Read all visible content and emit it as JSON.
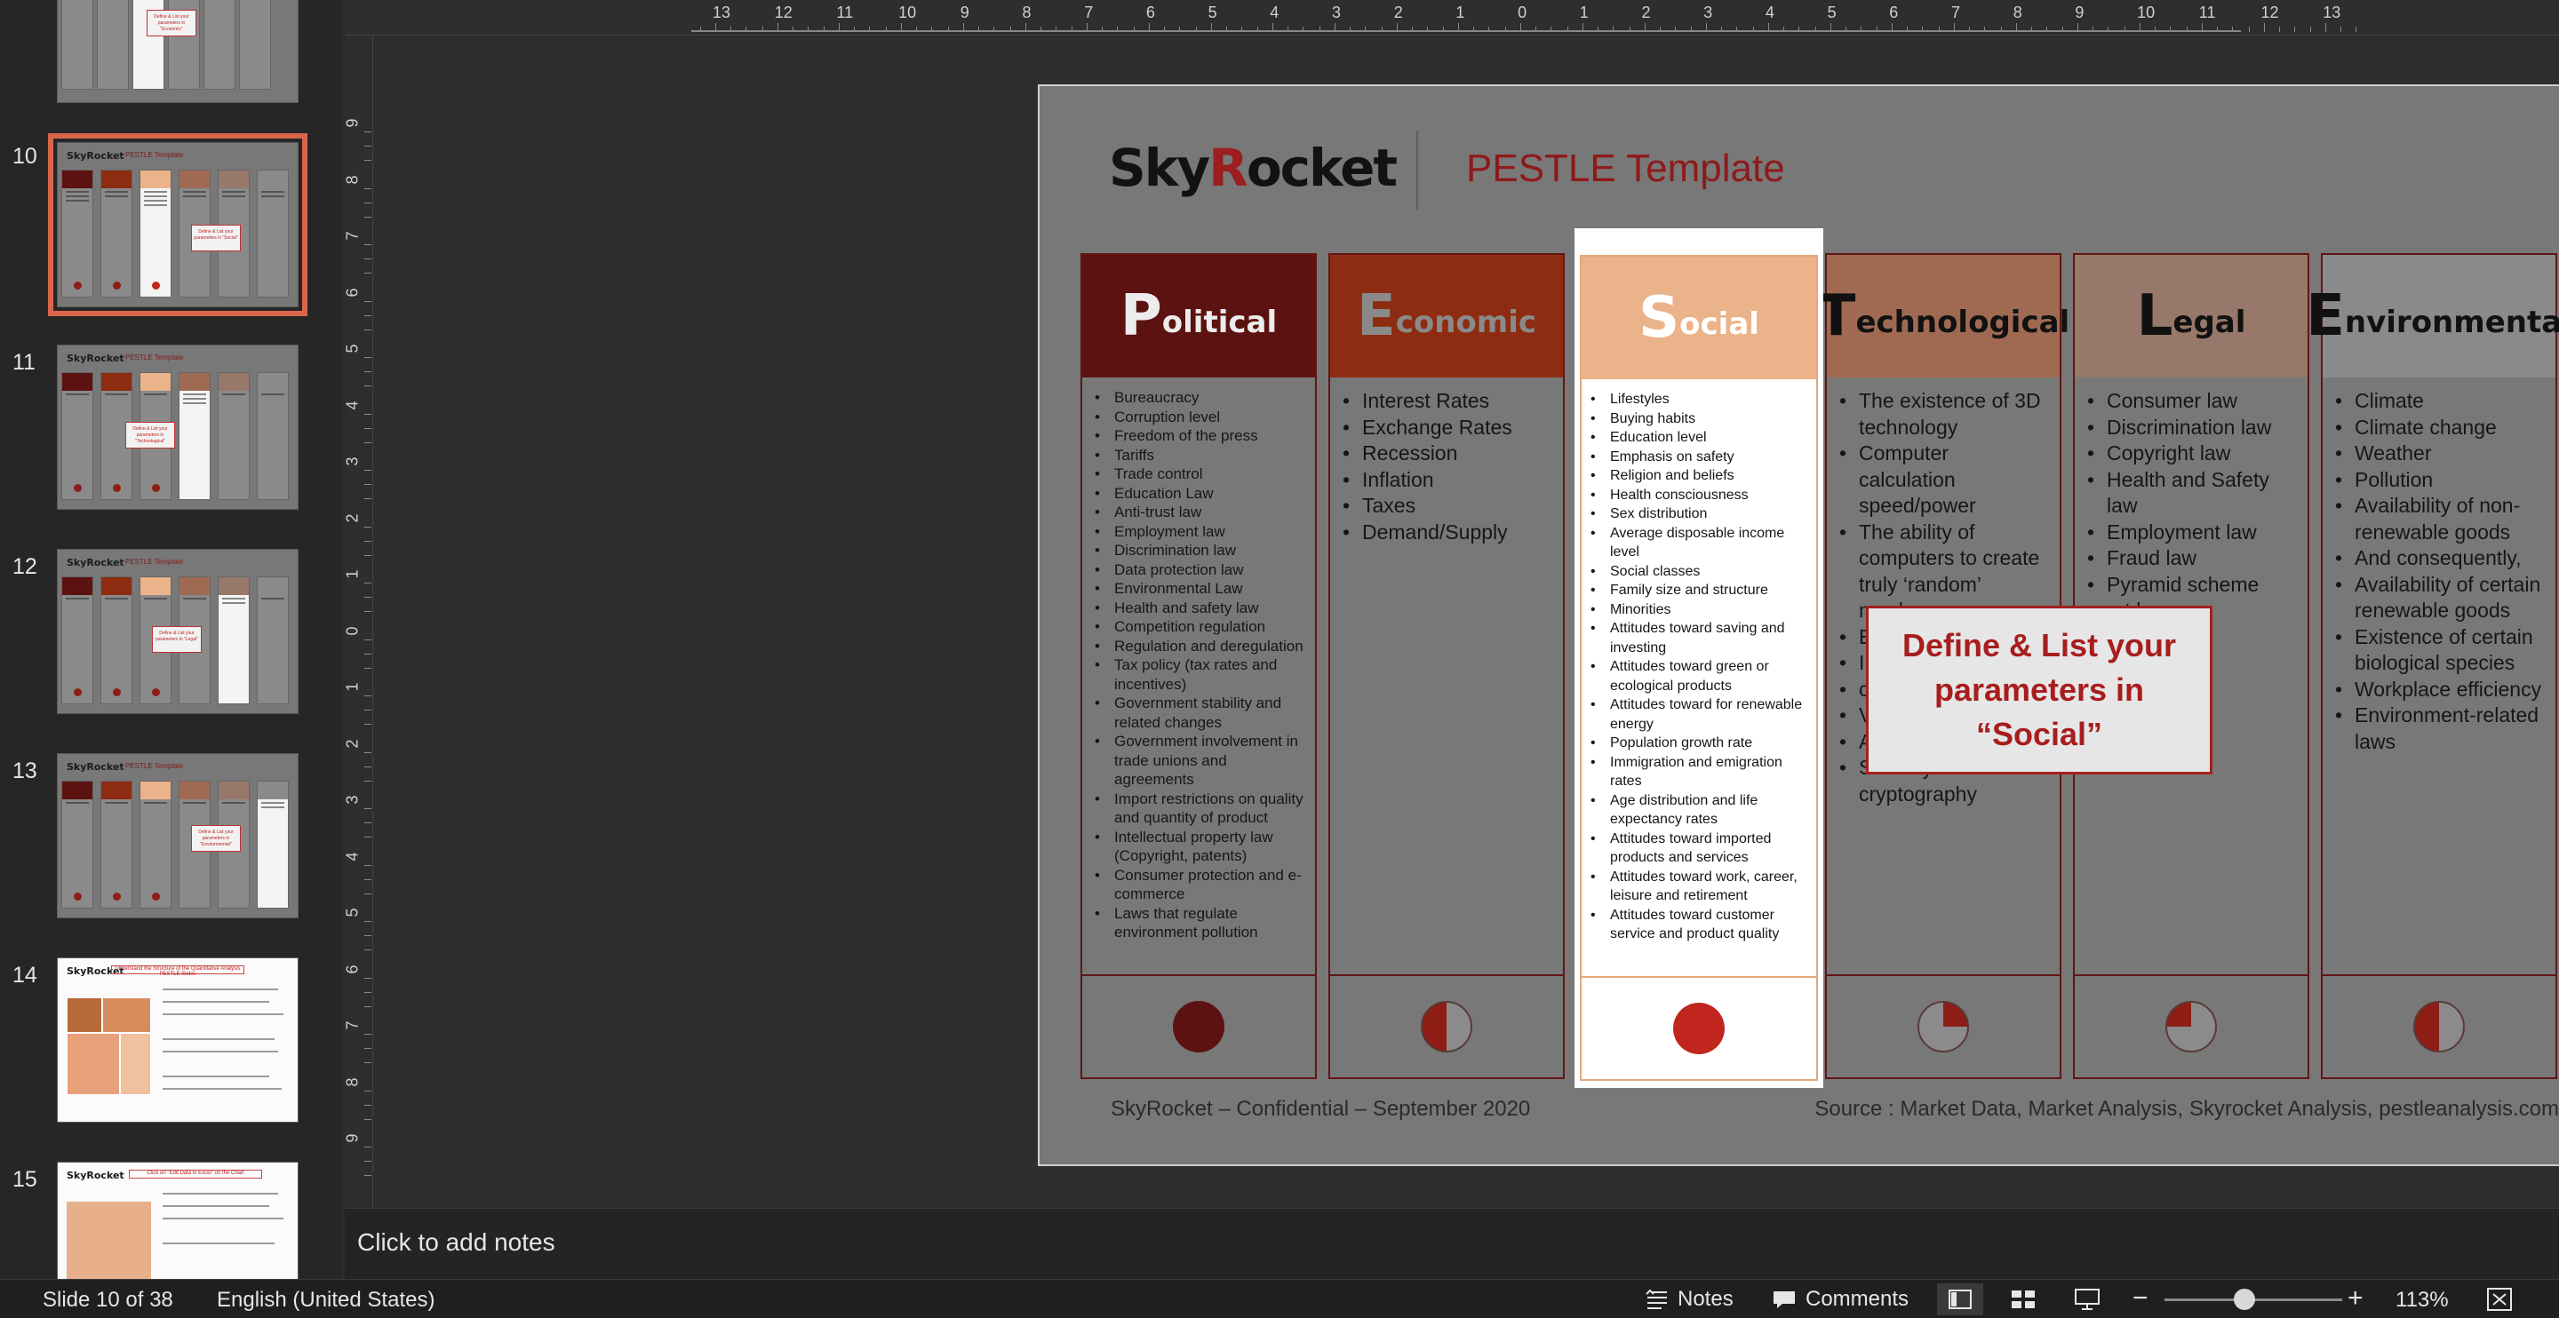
{
  "thumbnails": {
    "items": [
      {
        "number": "",
        "selected": false,
        "callout": "Define & List your parameters in \"Economic\""
      },
      {
        "number": "10",
        "selected": true,
        "callout": "Define & List your parameters in \"Social\""
      },
      {
        "number": "11",
        "selected": false,
        "callout": "Define & List your parameters in \"Technological\""
      },
      {
        "number": "12",
        "selected": false,
        "callout": "Define & List your parameters in \"Legal\""
      },
      {
        "number": "13",
        "selected": false,
        "callout": "Define & List your parameters in \"Environmental\""
      },
      {
        "number": "14",
        "selected": false,
        "callout": "Understand the Structure of the Quantitative Analysis PESTLE Slides"
      },
      {
        "number": "15",
        "selected": false,
        "callout": "Click on \"Edit Data in Excel\" on the Chart"
      }
    ]
  },
  "ruler": {
    "top_labels": [
      "13",
      "12",
      "11",
      "10",
      "9",
      "8",
      "7",
      "6",
      "5",
      "4",
      "3",
      "2",
      "1",
      "0",
      "1",
      "2",
      "3",
      "4",
      "5",
      "6",
      "7",
      "8",
      "9",
      "10",
      "11",
      "12",
      "13"
    ],
    "left_labels": [
      "9",
      "8",
      "7",
      "6",
      "5",
      "4",
      "3",
      "2",
      "1",
      "0",
      "1",
      "2",
      "3",
      "4",
      "5",
      "6",
      "7",
      "8",
      "9"
    ]
  },
  "slide": {
    "logo_pre": "Sky",
    "logo_r": "R",
    "logo_post": "ocket",
    "title": "PESTLE Template",
    "columns": [
      {
        "letter": "P",
        "rest": "olitical",
        "items": [
          "Bureaucracy",
          "Corruption level",
          "Freedom of the press",
          "Tariffs",
          "Trade control",
          "Education Law",
          "Anti-trust law",
          "Employment law",
          "Discrimination law",
          "Data protection law",
          "Environmental Law",
          "Health and safety law",
          "Competition regulation",
          "Regulation and deregulation",
          "Tax policy (tax rates and incentives)",
          "Government stability and related changes",
          "Government involvement in trade unions and agreements",
          "Import restrictions on quality and quantity of product",
          "Intellectual property law (Copyright, patents)",
          "Consumer protection and e-commerce",
          "Laws that regulate environment pollution"
        ]
      },
      {
        "letter": "E",
        "rest": "conomic",
        "items": [
          "Interest Rates",
          "Exchange Rates",
          "Recession",
          "Inflation",
          "Taxes",
          "Demand/Supply"
        ]
      },
      {
        "letter": "S",
        "rest": "ocial",
        "items": [
          "Lifestyles",
          "Buying habits",
          "Education level",
          "Emphasis on safety",
          "Religion and beliefs",
          "Health consciousness",
          "Sex distribution",
          "Average disposable income level",
          "Social classes",
          "Family size and structure",
          "Minorities",
          "Attitudes toward saving and investing",
          "Attitudes toward green or ecological products",
          "Attitudes toward for renewable energy",
          "Population growth rate",
          "Immigration and emigration rates",
          "Age distribution and life expectancy rates",
          "Attitudes toward imported products and services",
          "Attitudes toward work, career, leisure and retirement",
          "Attitudes toward customer service and product quality"
        ]
      },
      {
        "letter": "T",
        "rest": "echnological",
        "items": [
          "The existence of 3D technology",
          "Computer calculation speed/power",
          "The ability of computers to create truly ‘random’ numbers",
          "E",
          "I",
          "c",
          "V",
          "A",
          "Security in cryptography"
        ]
      },
      {
        "letter": "L",
        "rest": "egal",
        "items": [
          "Consumer law",
          "Discrimination law",
          "Copyright law",
          "Health and Safety law",
          "Employment law",
          "Fraud law",
          "Pyramid scheme",
          "ort law"
        ]
      },
      {
        "letter": "E",
        "rest": "nvironmental",
        "items": [
          "Climate",
          "Climate change",
          "Weather",
          "Pollution",
          "Availability of non-renewable goods",
          "And consequently,",
          "Availability of certain renewable goods",
          "Existence of certain biological species",
          "Workplace efficiency",
          "Environment-related laws"
        ]
      }
    ],
    "callout": "Define & List your parameters in “Social”",
    "footer_left": "SkyRocket – Confidential – September 2020",
    "footer_right": "Source : Market Data, Market Analysis, Skyrocket Analysis, pestleanalysis.com"
  },
  "notes": {
    "placeholder": "Click to add notes"
  },
  "status": {
    "slide_info": "Slide 10 of 38",
    "language": "English (United States)",
    "notes_label": "Notes",
    "comments_label": "Comments",
    "zoom_minus": "−",
    "zoom_plus": "+",
    "zoom_value": "113%",
    "zoom_level_fraction": 0.45
  },
  "colors": {
    "accent_selected": "#d9664b",
    "political_head": "#5c1210",
    "economic_head": "#8e2c12",
    "social_head": "#ebb38a",
    "technological_head": "#a06a52",
    "legal_head": "#98786a",
    "environmental_head": "#8a8a8a",
    "callout_text": "#a81d1d"
  }
}
